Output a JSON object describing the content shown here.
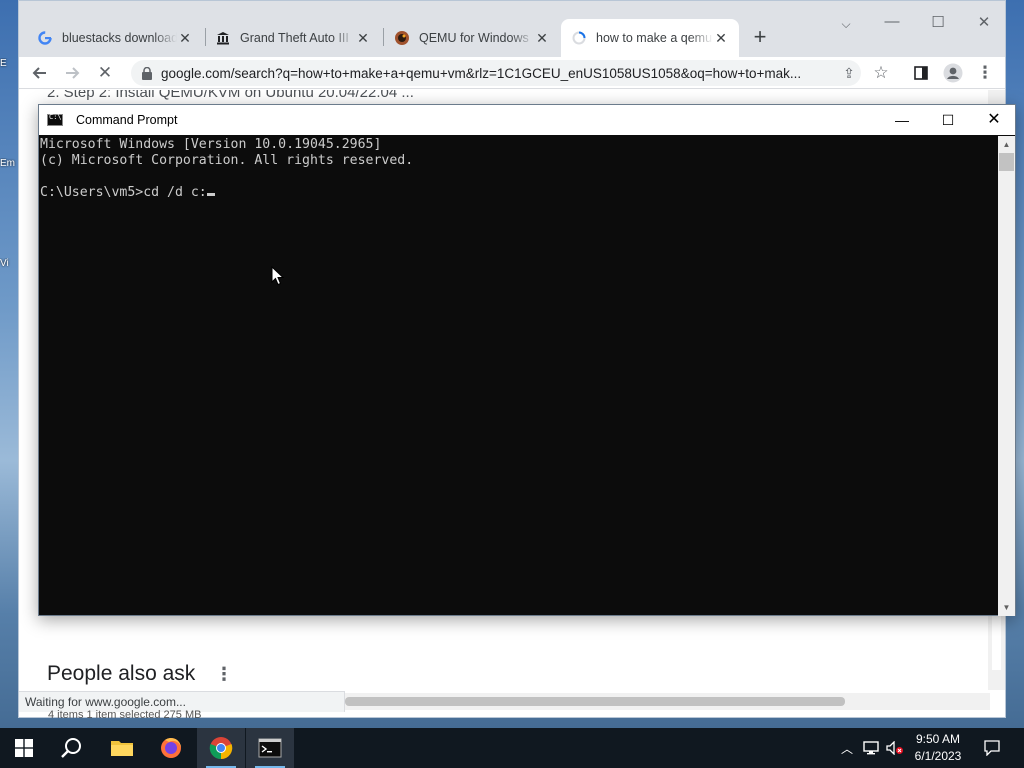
{
  "desktop": {
    "labels": [
      "E",
      "Em",
      "Vi"
    ]
  },
  "browser": {
    "tabs": [
      {
        "title": "bluestacks download",
        "icon": "google-icon"
      },
      {
        "title": "Grand Theft Auto III",
        "icon": "museum-icon"
      },
      {
        "title": "QEMU for Windows",
        "icon": "qemu-icon"
      },
      {
        "title": "how to make a qemu",
        "icon": "loading-spinner-icon",
        "active": true
      }
    ],
    "new_tab_symbol": "+",
    "url": "google.com/search?q=how+to+make+a+qemu+vm&rlz=1C1GCEU_enUS1058US1058&oq=how+to+mak...",
    "page": {
      "snippet_text": "2. Step 2: Install QEMU/KVM on Ubuntu 20.04/22.04 ...",
      "people_also_ask": "People also ask"
    },
    "status_text": "Waiting for www.google.com...",
    "behind_text": "4 items    1 item selected  275 MB"
  },
  "cmd": {
    "title": "Command Prompt",
    "lines": [
      "Microsoft Windows [Version 10.0.19045.2965]",
      "(c) Microsoft Corporation. All rights reserved.",
      "",
      "C:\\Users\\vm5>cd /d c:"
    ]
  },
  "taskbar": {
    "items": [
      "start-icon",
      "search-icon",
      "file-explorer-icon",
      "firefox-icon",
      "chrome-icon",
      "command-prompt-icon"
    ],
    "time": "9:50 AM",
    "date": "6/1/2023"
  },
  "colors": {
    "console_bg": "#0c0c0c",
    "console_fg": "#cccccc",
    "taskbar_bg": "#101820",
    "accent": "#76b9ed"
  }
}
